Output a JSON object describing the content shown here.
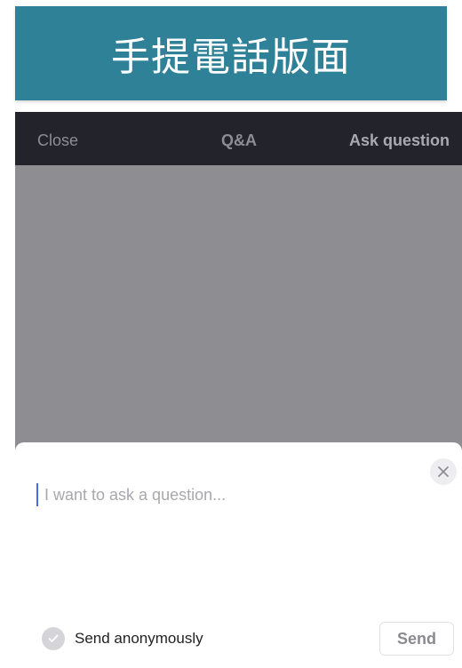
{
  "banner": {
    "title": "手提電話版面"
  },
  "topbar": {
    "close_label": "Close",
    "title": "Q&A",
    "ask_label": "Ask question"
  },
  "composer": {
    "placeholder": "I want to ask a question...",
    "value": "",
    "dismiss_icon": "close-icon",
    "anonymous_label": "Send anonymously",
    "anonymous_checked": false,
    "send_label": "Send"
  },
  "colors": {
    "banner_bg": "#2e8197",
    "topbar_bg": "#23242b",
    "backdrop": "#8e8d92",
    "cursor": "#4a6ee0"
  }
}
